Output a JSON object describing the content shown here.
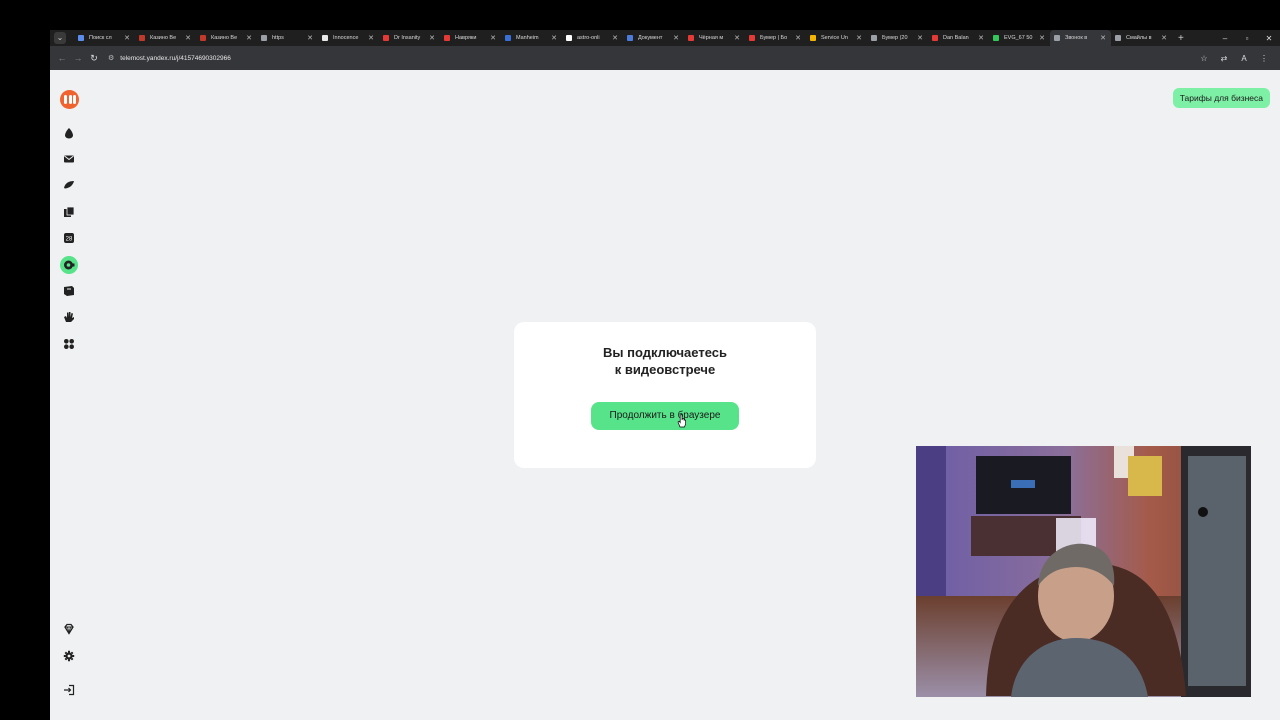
{
  "browser": {
    "tabs": [
      {
        "title": "Поиск сл",
        "favicon_color": "#5b8def"
      },
      {
        "title": "Казино Be",
        "favicon_color": "#c0392b"
      },
      {
        "title": "Казино Be",
        "favicon_color": "#c0392b"
      },
      {
        "title": "https",
        "favicon_color": "#9aa0a6"
      },
      {
        "title": "Innocence",
        "favicon_color": "#e8e8e8"
      },
      {
        "title": "Dr Insanity",
        "favicon_color": "#e53935"
      },
      {
        "title": "Навряки",
        "favicon_color": "#e53935"
      },
      {
        "title": "Manheim",
        "favicon_color": "#3a6fd8"
      },
      {
        "title": "astro-onli",
        "favicon_color": "#ffffff"
      },
      {
        "title": "Документ",
        "favicon_color": "#4c7bd9"
      },
      {
        "title": "Чёрная м",
        "favicon_color": "#e53935"
      },
      {
        "title": "Бумер | Бо",
        "favicon_color": "#e53935"
      },
      {
        "title": "Service Un",
        "favicon_color": "#f4b400"
      },
      {
        "title": "Бумер (20",
        "favicon_color": "#9aa0a6"
      },
      {
        "title": "Dan Balan",
        "favicon_color": "#e53935"
      },
      {
        "title": "EVG_67 50",
        "favicon_color": "#34c759"
      },
      {
        "title": "Звонок в",
        "favicon_color": "#9aa0a6",
        "active": true
      },
      {
        "title": "Смайлы в",
        "favicon_color": "#9aa0a6"
      }
    ],
    "new_tab": "+",
    "url": "telemost.yandex.ru/j/41574690302966",
    "window_controls": {
      "minimize": "–",
      "maximize": "▫",
      "close": "✕"
    }
  },
  "header": {
    "business_button": "Тарифы для бизнеса"
  },
  "sidebar": {
    "items": [
      {
        "name": "cloud-icon"
      },
      {
        "name": "mail-icon"
      },
      {
        "name": "messenger-icon"
      },
      {
        "name": "docs-icon"
      },
      {
        "name": "calendar-icon",
        "badge": "28"
      },
      {
        "name": "telemost-icon",
        "active": true
      },
      {
        "name": "notes-icon"
      },
      {
        "name": "hand-icon"
      },
      {
        "name": "apps-icon"
      }
    ],
    "bottom": [
      {
        "name": "premium-icon"
      },
      {
        "name": "settings-icon"
      },
      {
        "name": "logout-icon"
      }
    ]
  },
  "dialog": {
    "title_line1": "Вы подключаетесь",
    "title_line2": "к видеовстрече",
    "continue_button": "Продолжить в браузере"
  },
  "colors": {
    "accent": "#57e389",
    "logo": "#f0622e",
    "page_bg": "#eff1f3"
  }
}
